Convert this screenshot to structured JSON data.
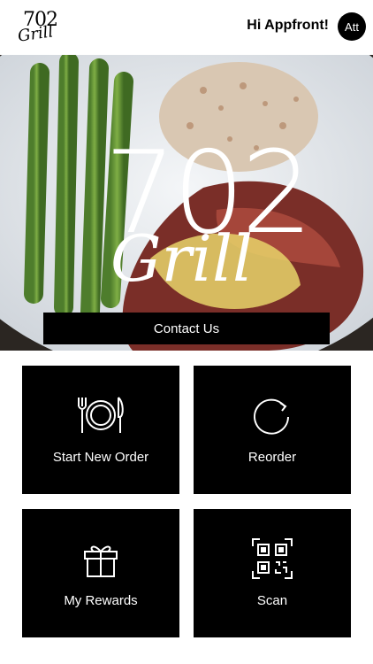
{
  "brand": {
    "logo_number": "702",
    "logo_script": "Grill"
  },
  "header": {
    "greeting": "Hi Appfront!",
    "avatar_initials": "Att"
  },
  "hero": {
    "title_number": "702",
    "title_script": "Grill",
    "contact_label": "Contact Us"
  },
  "tiles": [
    {
      "label": "Start New Order",
      "icon": "fork-plate-knife-icon"
    },
    {
      "label": "Reorder",
      "icon": "refresh-circle-icon"
    },
    {
      "label": "My Rewards",
      "icon": "gift-icon"
    },
    {
      "label": "Scan",
      "icon": "qr-code-icon"
    }
  ]
}
